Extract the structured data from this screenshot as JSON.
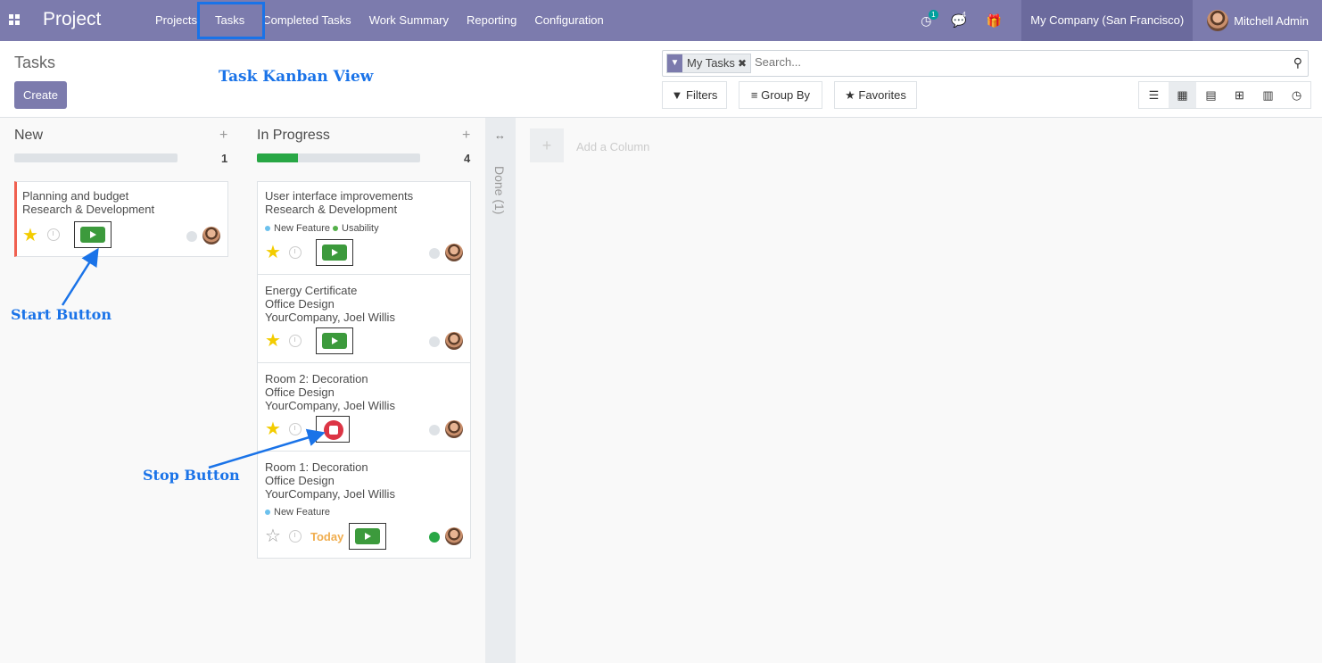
{
  "navbar": {
    "app_name": "Project",
    "menu": [
      "Projects",
      "Tasks",
      "Completed Tasks",
      "Work Summary",
      "Reporting",
      "Configuration"
    ],
    "activity_count": "1",
    "message_count": "4",
    "company": "My Company (San Francisco)",
    "user": "Mitchell Admin"
  },
  "control_panel": {
    "breadcrumb": "Tasks",
    "create_label": "Create",
    "facet_label": "My Tasks",
    "search_placeholder": "Search...",
    "filters_label": "Filters",
    "groupby_label": "Group By",
    "favorites_label": "Favorites"
  },
  "annotations": {
    "title": "Task Kanban View",
    "start": "Start Button",
    "stop": "Stop Button"
  },
  "columns": [
    {
      "title": "New",
      "count": "1",
      "progress": 0,
      "cards": [
        {
          "name": "Planning and budget",
          "project": "Research & Development",
          "starred": true,
          "timer": "start"
        }
      ]
    },
    {
      "title": "In Progress",
      "count": "4",
      "progress": 0.25,
      "cards": [
        {
          "name": "User interface improvements",
          "project": "Research & Development",
          "tags": [
            "New Feature",
            "Usability"
          ],
          "starred": true,
          "timer": "start"
        },
        {
          "name": "Energy Certificate",
          "project": "Office Design",
          "customer": "YourCompany, Joel Willis",
          "starred": true,
          "timer": "start"
        },
        {
          "name": "Room 2: Decoration",
          "project": "Office Design",
          "customer": "YourCompany, Joel Willis",
          "starred": true,
          "timer": "stop"
        },
        {
          "name": "Room 1: Decoration",
          "project": "Office Design",
          "customer": "YourCompany, Joel Willis",
          "tags": [
            "New Feature"
          ],
          "starred": false,
          "deadline": "Today",
          "timer": "start",
          "state": "done"
        }
      ]
    }
  ],
  "folded_column": "Done (1)",
  "add_column_label": "Add a Column",
  "colors": {
    "navbar": "#7c7bad",
    "tag_new_feature": "#6cc1ed",
    "tag_usability": "#55b04a",
    "timer_start": "#3c9a3c",
    "timer_stop": "#dc3545",
    "annotation": "#1a73e8"
  }
}
